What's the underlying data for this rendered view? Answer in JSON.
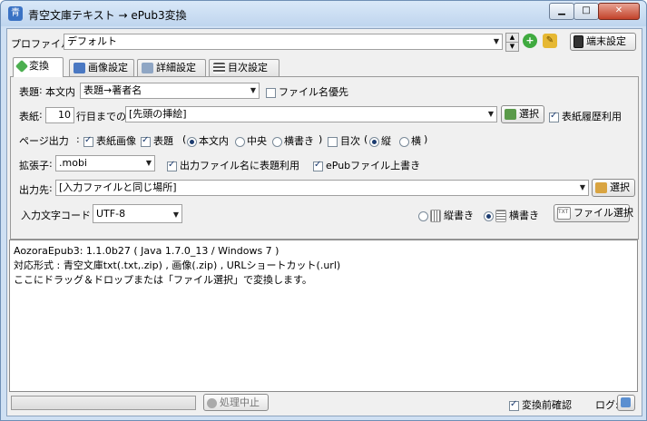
{
  "window": {
    "title": "青空文庫テキスト → ePub3変換"
  },
  "profile": {
    "label": "プロファイル:",
    "value": "デフォルト",
    "terminal_button": "端末設定"
  },
  "tabs": [
    {
      "label": "変換"
    },
    {
      "label": "画像設定"
    },
    {
      "label": "詳細設定"
    },
    {
      "label": "目次設定"
    }
  ],
  "title_row": {
    "label": "表題",
    "sub_label": "本文内",
    "select_value": "表題→著者名",
    "filename_priority": "ファイル名優先"
  },
  "cover_row": {
    "label": "表紙",
    "line_value": "10",
    "line_suffix": "行目までの",
    "select_value": "[先頭の挿絵]",
    "select_button": "選択",
    "history_label": "表紙履歴利用"
  },
  "page_output": {
    "label": "ページ出力",
    "cover_image": "表紙画像",
    "title_page": "表題",
    "paren_open": "(",
    "in_body": "本文内",
    "center": "中央",
    "horizontal": "横書き",
    "paren_close": ")",
    "toc": "目次",
    "paren_open_2": "(",
    "vertical": "縦",
    "horizontal_toc": "横",
    "paren_close_2": ")"
  },
  "extension_row": {
    "label": "拡張子",
    "value": ".mobi",
    "use_title_filename": "出力ファイル名に表題利用",
    "overwrite": "ePubファイル上書き"
  },
  "output_row": {
    "label": "出力先",
    "value": "[入力ファイルと同じ場所]",
    "select_button": "選択"
  },
  "encoding_row": {
    "label": "入力文字コード",
    "value": "UTF-8",
    "vertical_writing": "縦書き",
    "horizontal_writing": "横書き",
    "file_select_button": "ファイル選択"
  },
  "log": {
    "lines": [
      "AozoraEpub3: 1.1.0b27  ( Java 1.7.0_13  /  Windows 7 )",
      "対応形式 : 青空文庫txt(.txt,.zip) , 画像(.zip) , URLショートカット(.url)",
      "ここにドラッグ＆ドロップまたは「ファイル選択」で変換します。"
    ]
  },
  "status_bar": {
    "stop_button": "処理中止",
    "confirm_label": "変換前確認",
    "log_label": "ログ:"
  },
  "colors": {
    "title_bar": "#cfe0f3",
    "client": "#f0f0f0",
    "accent": "#1b3b6f"
  }
}
